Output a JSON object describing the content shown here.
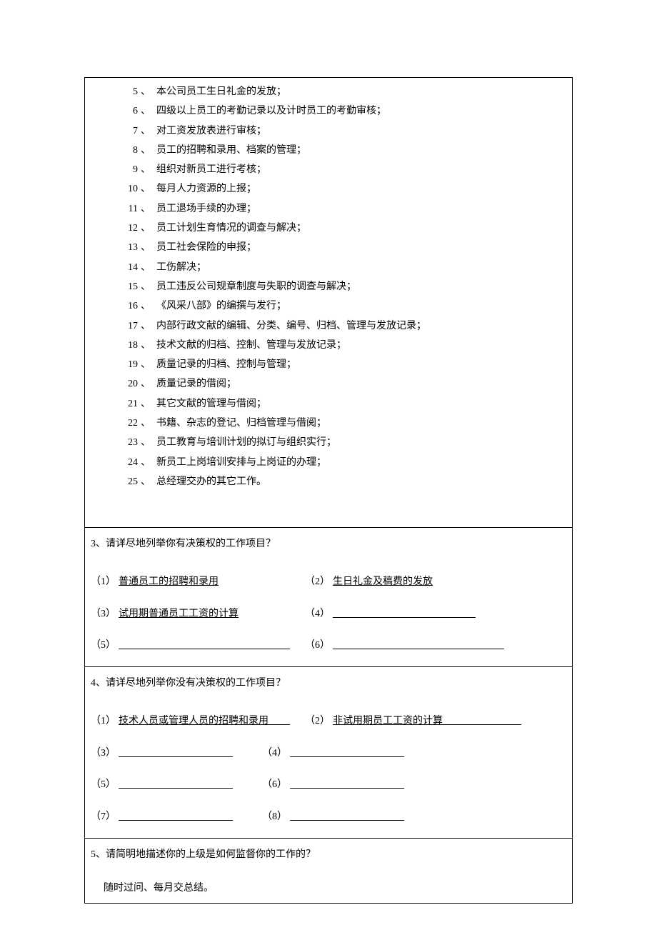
{
  "section2": {
    "items": [
      {
        "num": "5",
        "text": "本公司员工生日礼金的发放；"
      },
      {
        "num": "6",
        "text": "四级以上员工的考勤记录以及计时员工的考勤审核；"
      },
      {
        "num": "7",
        "text": "对工资发放表进行审核；"
      },
      {
        "num": "8",
        "text": "员工的招聘和录用、档案的管理；"
      },
      {
        "num": "9",
        "text": "组织对新员工进行考核；"
      },
      {
        "num": "10",
        "text": "每月人力资源的上报；"
      },
      {
        "num": "11",
        "text": "员工退场手续的办理；"
      },
      {
        "num": "12",
        "text": "员工计划生育情况的调查与解决；"
      },
      {
        "num": "13",
        "text": "员工社会保险的申报；"
      },
      {
        "num": "14",
        "text": "工伤解决；"
      },
      {
        "num": "15",
        "text": "员工违反公司规章制度与失职的调查与解决；"
      },
      {
        "num": "16",
        "text": "《风采八部》的编撰与发行；"
      },
      {
        "num": "17",
        "text": "内部行政文献的编辑、分类、编号、归档、管理与发放记录；"
      },
      {
        "num": "18",
        "text": "技术文献的归档、控制、管理与发放记录；"
      },
      {
        "num": "19",
        "text": "质量记录的归档、控制与管理；"
      },
      {
        "num": "20",
        "text": "质量记录的借阅；"
      },
      {
        "num": "21",
        "text": "其它文献的管理与借阅；"
      },
      {
        "num": "22",
        "text": "书籍、杂志的登记、归档管理与借阅；"
      },
      {
        "num": "23",
        "text": "员工教育与培训计划的拟订与组织实行；"
      },
      {
        "num": "24",
        "text": "新员工上岗培训安排与上岗证的办理；"
      },
      {
        "num": "25",
        "text": "总经理交办的其它工作。"
      }
    ]
  },
  "q3": {
    "prompt": "3、请详尽地列举你有决策权的工作项目？",
    "items": {
      "a1": {
        "label": "（1）",
        "text": "普通员工的招聘和录用"
      },
      "a2": {
        "label": "（2）",
        "text": "生日礼金及稿费的发放"
      },
      "a3": {
        "label": "（3）",
        "text": "试用期普通员工工资的计算"
      },
      "a4": {
        "label": "（4）",
        "text": ""
      },
      "a5": {
        "label": "（5）",
        "text": ""
      },
      "a6": {
        "label": "（6）",
        "text": ""
      }
    }
  },
  "q4": {
    "prompt": "4、请详尽地列举你没有决策权的工作项目？",
    "items": {
      "a1": {
        "label": "（1）",
        "text": "技术人员或管理人员的招聘和录用"
      },
      "a2": {
        "label": "（2）",
        "text": "非试用期员工工资的计算"
      },
      "a3": {
        "label": "（3）"
      },
      "a4": {
        "label": "（4）"
      },
      "a5": {
        "label": "（5）"
      },
      "a6": {
        "label": "（6）"
      },
      "a7": {
        "label": "（7）"
      },
      "a8": {
        "label": "（8）"
      }
    }
  },
  "q5": {
    "prompt": "5、请简明地描述你的上级是如何监督你的工作的？",
    "answer": "随时过问、每月交总结。"
  }
}
